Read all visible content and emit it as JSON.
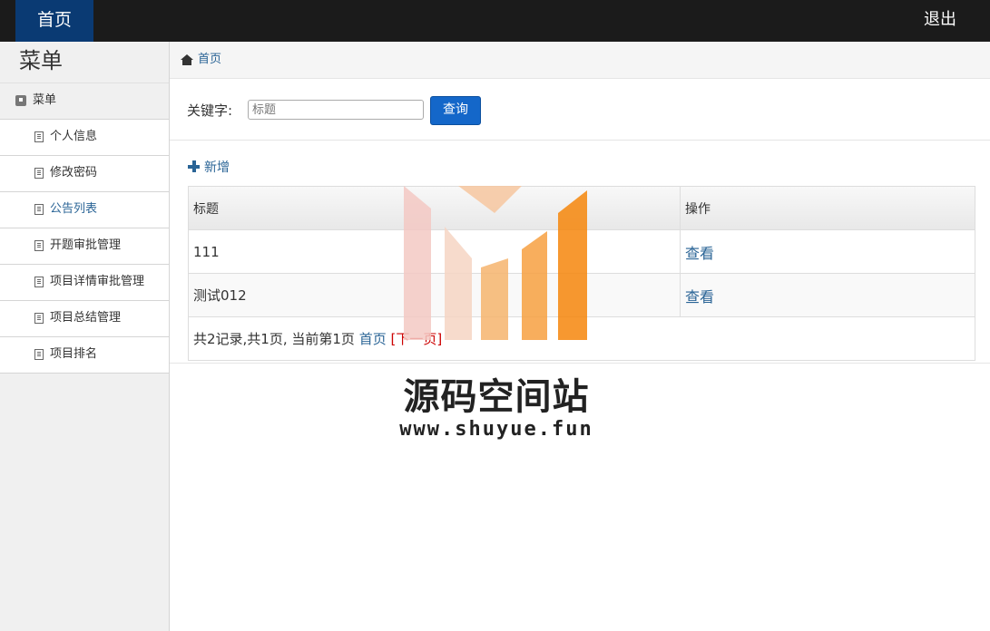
{
  "topbar": {
    "home": "首页",
    "logout": "退出"
  },
  "sidebar": {
    "title": "菜单",
    "group": "菜单",
    "items": [
      {
        "label": "个人信息"
      },
      {
        "label": "修改密码"
      },
      {
        "label": "公告列表"
      },
      {
        "label": "开题审批管理"
      },
      {
        "label": "项目详情审批管理"
      },
      {
        "label": "项目总结管理"
      },
      {
        "label": "项目排名"
      }
    ]
  },
  "breadcrumb": {
    "home": "首页"
  },
  "search": {
    "label": "关键字:",
    "placeholder": "标题",
    "button": "查询"
  },
  "add_label": "新增",
  "table": {
    "headers": [
      "标题",
      "操作"
    ],
    "rows": [
      {
        "title": "111",
        "action": "查看"
      },
      {
        "title": "测试012",
        "action": "查看"
      }
    ],
    "pager_text": "共2记录,共1页, 当前第1页",
    "pager_first": "首页",
    "pager_next": "[下一页]"
  },
  "watermark": {
    "name": "源码空间站",
    "url": "www.shuyue.fun"
  }
}
